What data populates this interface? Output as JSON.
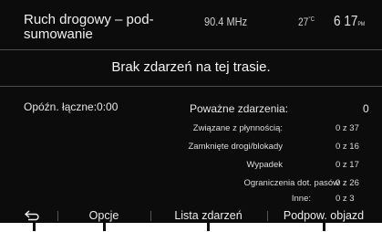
{
  "header": {
    "title": "Ruch drogowy – pod-sumowanie",
    "frequency": "90.4 MHz",
    "temperature": "27",
    "temperature_unit": "°C",
    "time": "6 17",
    "time_suffix": "PM"
  },
  "message": "Brak zdarzeń na tej trasie.",
  "summary": {
    "delay_label": "Opóźn. łączne:",
    "delay_value": "0:00",
    "serious_label": "Poważne zdarzenia:",
    "serious_value": "0",
    "rows": [
      {
        "label": "Związane z płynnością:",
        "value": "0 z 37"
      },
      {
        "label": "Zamknięte drogi/blokady",
        "value": "0 z 16"
      },
      {
        "label": "Wypadek",
        "value": "0 z 17"
      },
      {
        "label": "Ograniczenia dot. pasów",
        "value": "0 z 26"
      },
      {
        "label": "Inne:",
        "value": "0 z 3"
      }
    ]
  },
  "bottom": {
    "back_icon": "back-arrow-icon",
    "options": "Opcje",
    "events_list": "Lista zdarzeń",
    "detour": "Podpow. objazd"
  }
}
